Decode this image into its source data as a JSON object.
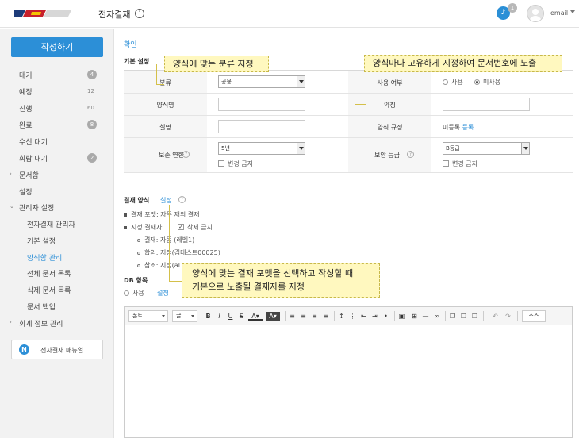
{
  "header": {
    "app_title": "전자결재",
    "notification_count": "1",
    "user_label": "email"
  },
  "sidebar": {
    "compose_label": "작성하기",
    "items": [
      {
        "label": "대기",
        "count": "4",
        "count_style": "badge"
      },
      {
        "label": "예정",
        "count": "12",
        "count_style": "plain"
      },
      {
        "label": "진행",
        "count": "60",
        "count_style": "plain"
      },
      {
        "label": "완료",
        "count": "8",
        "count_style": "badge"
      },
      {
        "label": "수신 대기"
      },
      {
        "label": "회람 대기",
        "count": "2",
        "count_style": "badge"
      },
      {
        "label": "문서함",
        "collapsible": true
      },
      {
        "label": "설정"
      },
      {
        "label": "관리자 설정",
        "expanded": true
      }
    ],
    "admin_items": [
      "전자결재 관리자",
      "기본 설정",
      "양식함 관리",
      "전체 문서 목록",
      "삭제 문서 목록",
      "문서 백업"
    ],
    "active_admin_item": "양식함 관리",
    "accounting_label": "회계 정보 관리",
    "manual_label": "전자결재 매뉴얼"
  },
  "main": {
    "confirm_label": "확인",
    "basic_section_title": "기본 설정",
    "fields": {
      "category_label": "분류",
      "category_value": "공용",
      "usage_label": "사용 여부",
      "usage_options": [
        "사용",
        "미사용"
      ],
      "usage_selected": "미사용",
      "form_name_label": "양식명",
      "abbr_label": "약칭",
      "description_label": "설명",
      "rule_label": "양식 규정",
      "rule_status": "미등록",
      "rule_register_link": "등록",
      "retention_label": "보존 연한",
      "retention_value": "5년",
      "retention_lock_label": "변경 금지",
      "security_label": "보안 등급",
      "security_value": "B등급",
      "security_lock_label": "변경 금지"
    },
    "approval_section_title": "결재 양식",
    "approval_setting_link": "설정",
    "approval_lines": {
      "format": "결재 포맷: 자무 재외 결재",
      "designated": "지정 결재자",
      "delete_forbid": "삭제 금지",
      "sub_items": [
        "결재: 자동 (레벨1)",
        "합의: 지정(김테스트00025)",
        "참조: 지정(al"
      ]
    },
    "db_section_title": "DB 항목",
    "db_use_label": "사용",
    "db_setting_link": "설정",
    "editor": {
      "font_label": "폰트",
      "size_label": "글...",
      "source_label": "소스"
    }
  },
  "callouts": {
    "category": "양식에 맞는 분류 지정",
    "abbr": "양식마다 고유하게 지정하여 문서번호에 노출",
    "approval": "양식에 맞는 결재 포맷을 선택하고 작성할 때\n기본으로 노출될 결재자를 지정"
  },
  "colors": {
    "accent": "#2c8fd7",
    "callout_bg": "#fff8bf"
  }
}
